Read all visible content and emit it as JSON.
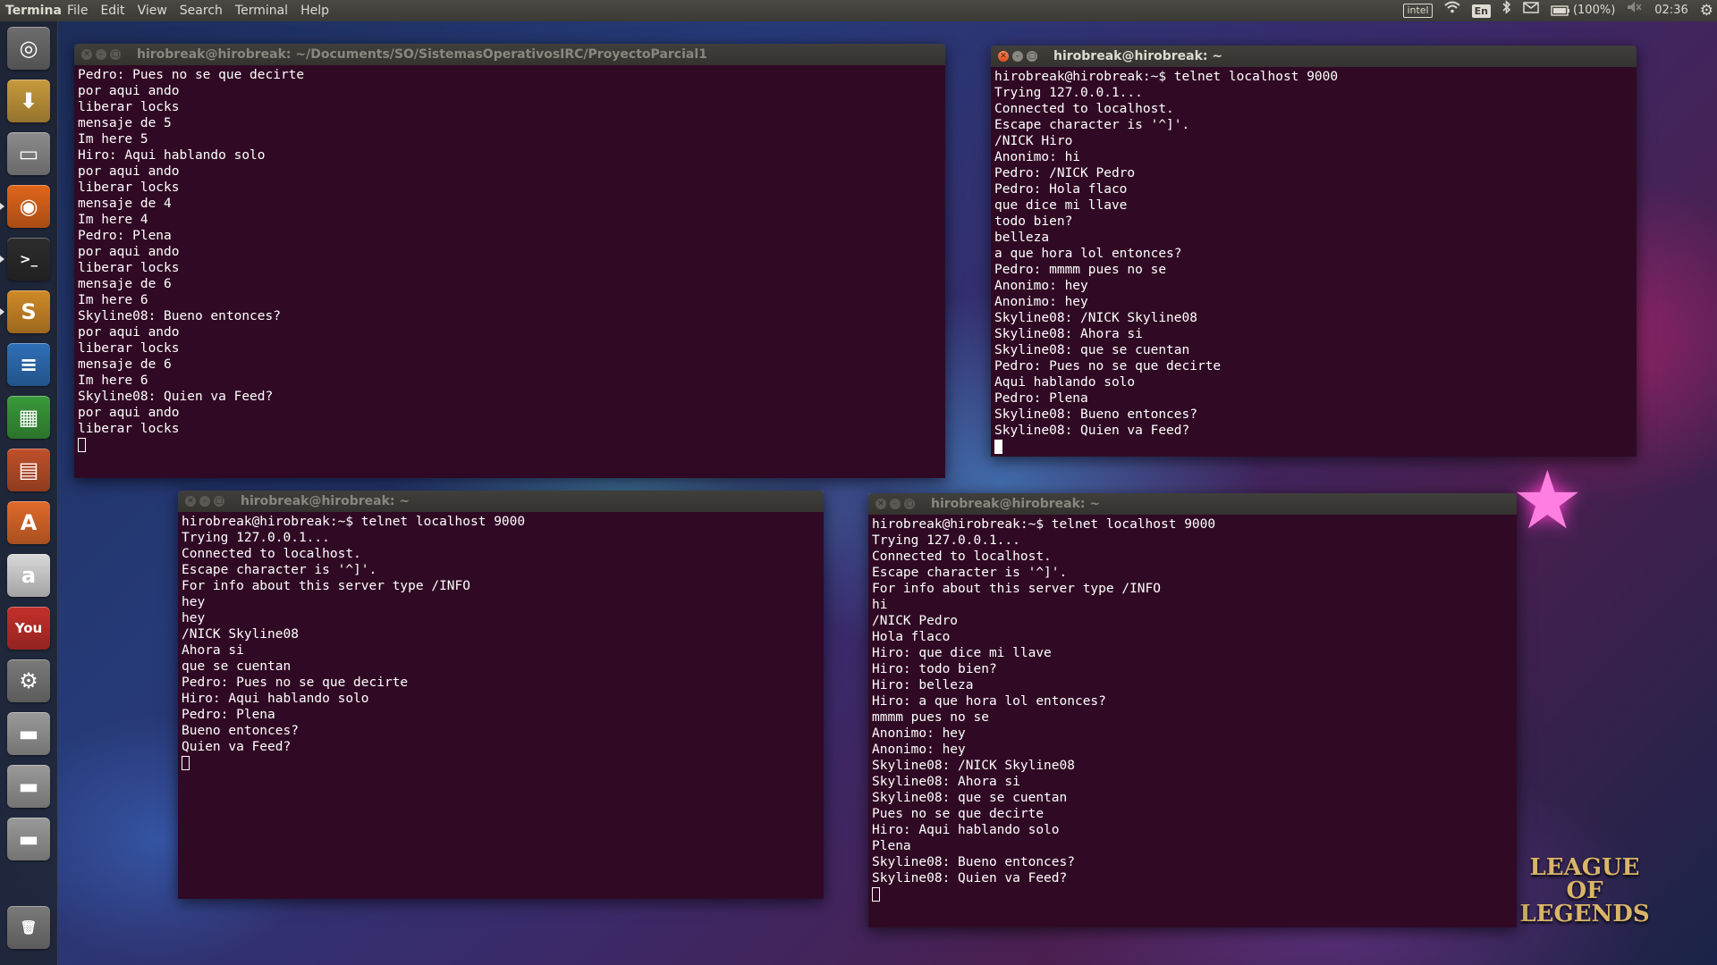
{
  "top_panel": {
    "app_name": "Terminal",
    "menu": [
      "File",
      "Edit",
      "View",
      "Search",
      "Terminal",
      "Help"
    ],
    "indicators": {
      "intel": "intel",
      "keyboard_layout": "En",
      "battery_percent": "(100%)",
      "clock": "02:36"
    }
  },
  "launcher": [
    {
      "name": "dash-home-icon",
      "glyph": "◎",
      "color": "#6d6d6d"
    },
    {
      "name": "files-download-icon",
      "glyph": "⬇",
      "color": "#c79a3c"
    },
    {
      "name": "file-manager-icon",
      "glyph": "▭",
      "color": "#8c8c8c"
    },
    {
      "name": "firefox-icon",
      "glyph": "◉",
      "color": "#e0661b"
    },
    {
      "name": "terminal-icon",
      "glyph": ">_",
      "color": "#2c2c2c"
    },
    {
      "name": "sublime-text-icon",
      "glyph": "S",
      "color": "#d08a27"
    },
    {
      "name": "writer-icon",
      "glyph": "≡",
      "color": "#2f6fb8"
    },
    {
      "name": "calc-icon",
      "glyph": "▦",
      "color": "#3a9a3a"
    },
    {
      "name": "impress-icon",
      "glyph": "▤",
      "color": "#c0502a"
    },
    {
      "name": "software-center-icon",
      "glyph": "A",
      "color": "#e06a2a"
    },
    {
      "name": "amazon-icon",
      "glyph": "a",
      "color": "#d9d9d9"
    },
    {
      "name": "youtube-icon",
      "glyph": "You",
      "color": "#c4302b"
    },
    {
      "name": "system-settings-icon",
      "glyph": "⚙",
      "color": "#7a7a7a"
    },
    {
      "name": "drive-icon-1",
      "glyph": "▬",
      "color": "#9a9a9a"
    },
    {
      "name": "drive-icon-2",
      "glyph": "▬",
      "color": "#9a9a9a"
    },
    {
      "name": "drive-icon-3",
      "glyph": "▬",
      "color": "#9a9a9a"
    },
    {
      "name": "trash-icon",
      "glyph": "🗑",
      "color": "#7a7a7a"
    }
  ],
  "windows": [
    {
      "title": "hirobreak@hirobreak: ~/Documents/SO/SistemasOperativosIRC/ProyectoParcial1",
      "lines": [
        "Pedro: Pues no se que decirte",
        "por aqui ando",
        "liberar locks",
        "mensaje de 5",
        "Im here 5",
        "Hiro: Aqui hablando solo",
        "por aqui ando",
        "liberar locks",
        "mensaje de 4",
        "Im here 4",
        "Pedro: Plena",
        "por aqui ando",
        "liberar locks",
        "mensaje de 6",
        "Im here 6",
        "Skyline08: Bueno entonces?",
        "por aqui ando",
        "liberar locks",
        "mensaje de 6",
        "Im here 6",
        "Skyline08: Quien va Feed?",
        "por aqui ando",
        "liberar locks"
      ]
    },
    {
      "title": "hirobreak@hirobreak: ~",
      "lines": [
        "hirobreak@hirobreak:~$ telnet localhost 9000",
        "Trying 127.0.0.1...",
        "Connected to localhost.",
        "Escape character is '^]'.",
        "/NICK Hiro",
        "Anonimo: hi",
        "Pedro: /NICK Pedro",
        "Pedro: Hola flaco",
        "que dice mi llave",
        "todo bien?",
        "belleza",
        "a que hora lol entonces?",
        "Pedro: mmmm pues no se",
        "Anonimo: hey",
        "Anonimo: hey",
        "Skyline08: /NICK Skyline08",
        "Skyline08: Ahora si",
        "Skyline08: que se cuentan",
        "Pedro: Pues no se que decirte",
        "Aqui hablando solo",
        "Pedro: Plena",
        "Skyline08: Bueno entonces?",
        "Skyline08: Quien va Feed?"
      ]
    },
    {
      "title": "hirobreak@hirobreak: ~",
      "lines": [
        "hirobreak@hirobreak:~$ telnet localhost 9000",
        "Trying 127.0.0.1...",
        "Connected to localhost.",
        "Escape character is '^]'.",
        "For info about this server type /INFO",
        "hey",
        "hey",
        "/NICK Skyline08",
        "Ahora si",
        "que se cuentan",
        "Pedro: Pues no se que decirte",
        "Hiro: Aqui hablando solo",
        "Pedro: Plena",
        "Bueno entonces?",
        "Quien va Feed?"
      ]
    },
    {
      "title": "hirobreak@hirobreak: ~",
      "lines": [
        "hirobreak@hirobreak:~$ telnet localhost 9000",
        "Trying 127.0.0.1...",
        "Connected to localhost.",
        "Escape character is '^]'.",
        "For info about this server type /INFO",
        "hi",
        "/NICK Pedro",
        "Hola flaco",
        "Hiro: que dice mi llave",
        "Hiro: todo bien?",
        "Hiro: belleza",
        "Hiro: a que hora lol entonces?",
        "mmmm pues no se",
        "Anonimo: hey",
        "Anonimo: hey",
        "Skyline08: /NICK Skyline08",
        "Skyline08: Ahora si",
        "Skyline08: que se cuentan",
        "Pues no se que decirte",
        "Hiro: Aqui hablando solo",
        "Plena",
        "Skyline08: Bueno entonces?",
        "Skyline08: Quien va Feed?"
      ]
    }
  ],
  "wallpaper": {
    "logo_text": "LEAGUE OF LEGENDS",
    "colors": {
      "terminal_bg": "#300a24",
      "panel_bg": "#3b3a36",
      "close_button": "#df4a16"
    }
  }
}
